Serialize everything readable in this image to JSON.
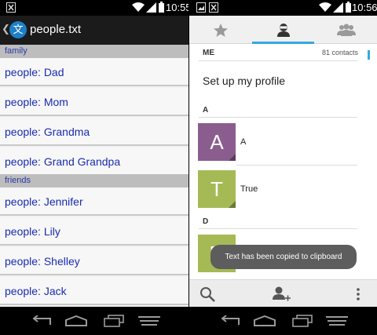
{
  "left_status": {
    "time": "10:55"
  },
  "right_status": {
    "time": "10:56"
  },
  "left_app": {
    "app_icon_glyph": "文",
    "title": "people.txt",
    "sections": [
      {
        "header": "family",
        "items": [
          "people: Dad",
          "people: Mom",
          "people: Grandma",
          "people: Grand Grandpa"
        ]
      },
      {
        "header": "friends",
        "items": [
          "people: Jennifer",
          "people: Lily",
          "people: Shelley",
          "people: Jack"
        ]
      }
    ]
  },
  "right_app": {
    "tabs": [
      "favorites-tab",
      "me-tab",
      "groups-tab"
    ],
    "me_label": "ME",
    "contact_count": "81 contacts",
    "setup_profile": "Set up my profile",
    "groups": [
      {
        "letter": "A",
        "contacts": [
          {
            "initial": "A",
            "name": "A",
            "color": "#8b5d8e"
          },
          {
            "initial": "T",
            "name": "True",
            "color": "#a5ba55"
          }
        ]
      },
      {
        "letter": "D",
        "contacts": [
          {
            "initial": "D",
            "name": "",
            "color": "#a5ba55"
          }
        ]
      }
    ],
    "toast": "Text has been copied to clipboard"
  },
  "colors": {
    "accent": "#35a8e0",
    "section_header_bg": "#bdbdbd",
    "list_text": "#1a2bb0"
  }
}
